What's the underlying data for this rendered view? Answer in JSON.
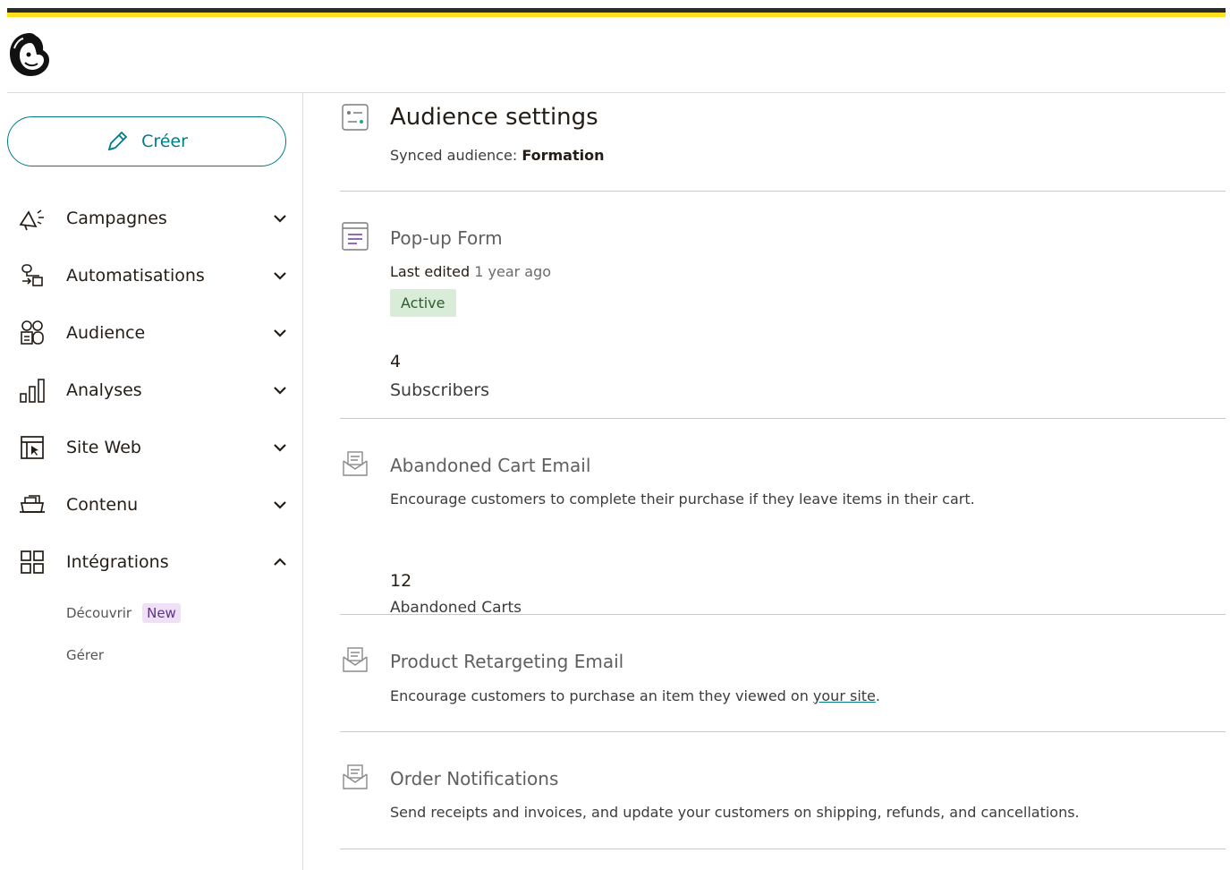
{
  "brand": {
    "accent": "#007c89",
    "highlight": "#ffe01b",
    "logo_icon": "freddie-logo-icon"
  },
  "sidebar": {
    "create_label": "Créer",
    "items": [
      {
        "label": "Campagnes",
        "icon": "megaphone-icon",
        "expanded": false
      },
      {
        "label": "Automatisations",
        "icon": "automation-icon",
        "expanded": false
      },
      {
        "label": "Audience",
        "icon": "audience-icon",
        "expanded": false
      },
      {
        "label": "Analyses",
        "icon": "bar-chart-icon",
        "expanded": false
      },
      {
        "label": "Site Web",
        "icon": "website-icon",
        "expanded": false
      },
      {
        "label": "Contenu",
        "icon": "content-icon",
        "expanded": false
      },
      {
        "label": "Intégrations",
        "icon": "grid-icon",
        "expanded": true
      }
    ],
    "sub_items": [
      {
        "label": "Découvrir",
        "badge": "New"
      },
      {
        "label": "Gérer"
      }
    ]
  },
  "main": {
    "audience_settings": {
      "title": "Audience settings",
      "synced_prefix": "Synced audience:",
      "synced_value": "Formation"
    },
    "popup_form": {
      "title": "Pop-up Form",
      "last_edited_label": "Last edited",
      "last_edited_value": "1 year ago",
      "status": "Active",
      "stat_value": "4",
      "stat_label": "Subscribers"
    },
    "abandoned_cart": {
      "title": "Abandoned Cart Email",
      "description": "Encourage customers to complete their purchase if they leave items in their cart.",
      "stat_value": "12",
      "stat_label": "Abandoned Carts"
    },
    "product_retargeting": {
      "title": "Product Retargeting Email",
      "description_prefix": "Encourage customers to purchase an item they viewed on",
      "link_text": "your site",
      "description_suffix": "."
    },
    "order_notifications": {
      "title": "Order Notifications",
      "description": "Send receipts and invoices, and update your customers on shipping, refunds, and cancellations."
    }
  }
}
